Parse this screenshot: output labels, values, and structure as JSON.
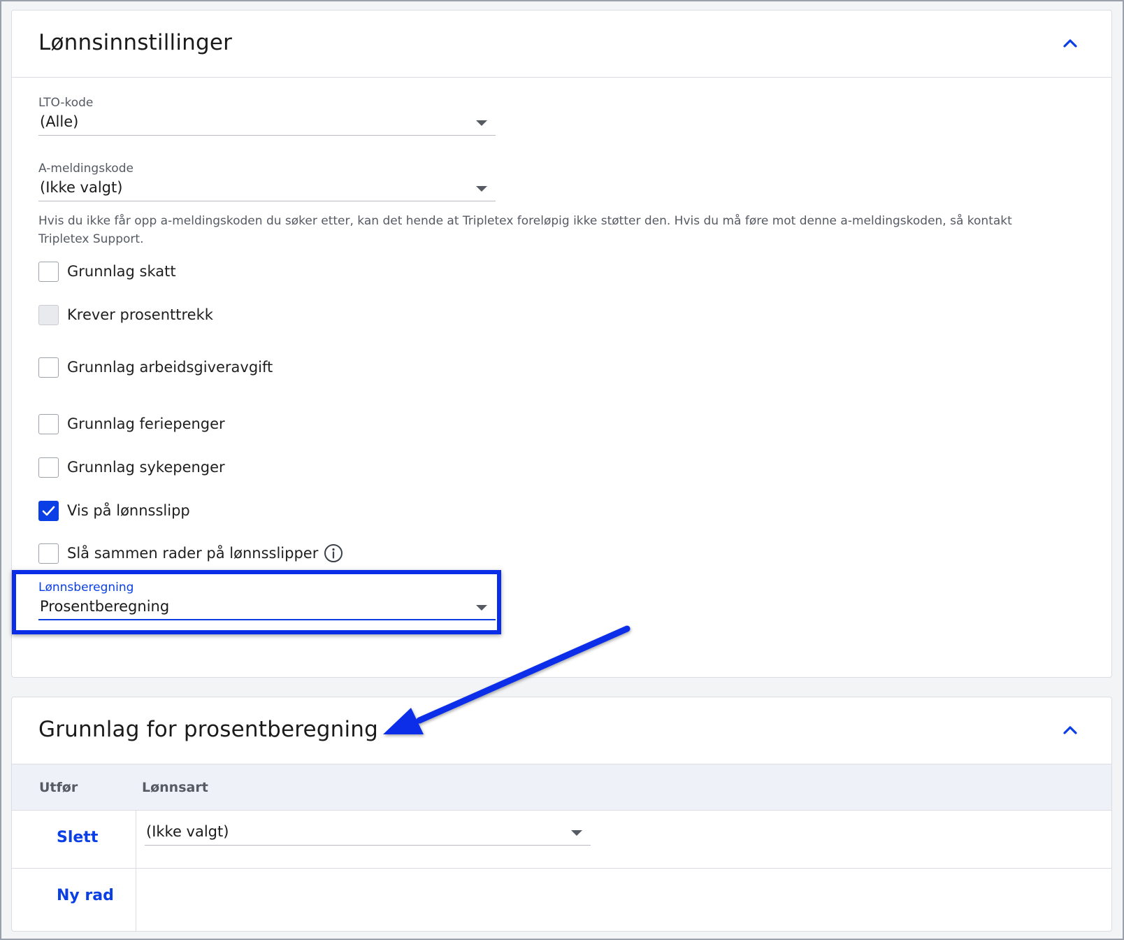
{
  "salary_settings": {
    "title": "Lønnsinnstillinger",
    "collapse_icon": "chevron-up-icon",
    "lto_code": {
      "label": "LTO-kode",
      "value": "(Alle)"
    },
    "a_message_code": {
      "label": "A-meldingskode",
      "value": "(Ikke valgt)",
      "help": "Hvis du ikke får opp a-meldingskoden du søker etter, kan det hende at Tripletex foreløpig ikke støtter den. Hvis du må føre mot denne a-meldingskoden, så kontakt Tripletex Support."
    },
    "checkboxes": [
      {
        "label": "Grunnlag skatt",
        "checked": false,
        "disabled": false
      },
      {
        "label": "Krever prosenttrekk",
        "checked": false,
        "disabled": true
      },
      {
        "label": "Grunnlag arbeidsgiveravgift",
        "checked": false,
        "disabled": false
      },
      {
        "label": "Grunnlag feriepenger",
        "checked": false,
        "disabled": false
      },
      {
        "label": "Grunnlag sykepenger",
        "checked": false,
        "disabled": false
      },
      {
        "label": "Vis på lønnsslipp",
        "checked": true,
        "disabled": false
      },
      {
        "label": "Slå sammen rader på lønnsslipper",
        "checked": false,
        "disabled": false,
        "info_icon": "info-icon"
      }
    ],
    "salary_calculation": {
      "label": "Lønnsberegning",
      "value": "Prosentberegning"
    }
  },
  "percent_basis": {
    "title": "Grunnlag for prosentberegning",
    "collapse_icon": "chevron-up-icon",
    "columns": [
      "Utfør",
      "Lønnsart"
    ],
    "rows": [
      {
        "action": "Slett",
        "salary_type": "(Ikke valgt)"
      }
    ],
    "new_row_label": "Ny rad"
  },
  "colors": {
    "accent": "#0a3fe6",
    "annotation": "#0a2ee8",
    "table_header_bg": "#eef1f8",
    "border": "#dcdde2"
  }
}
